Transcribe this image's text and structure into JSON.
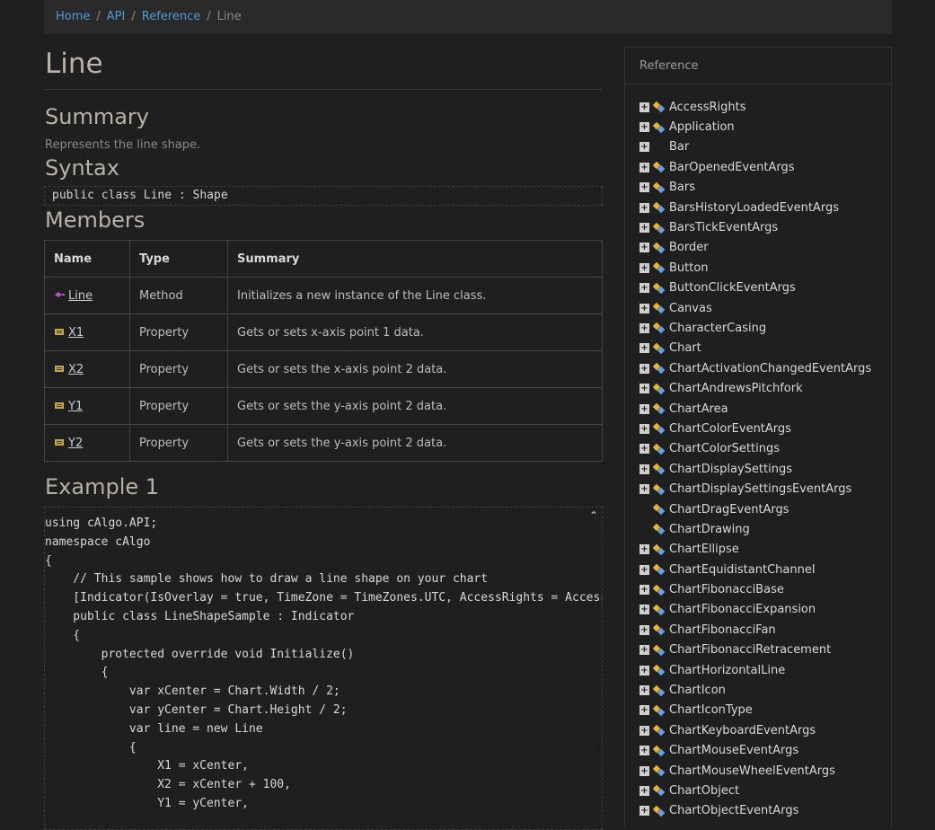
{
  "breadcrumb": {
    "items": [
      "Home",
      "API",
      "Reference"
    ],
    "current": "Line"
  },
  "page": {
    "title": "Line",
    "summary_heading": "Summary",
    "summary_text": "Represents the line shape.",
    "syntax_heading": "Syntax",
    "syntax_code": "public class Line : Shape",
    "members_heading": "Members",
    "example_heading": "Example 1"
  },
  "members_table": {
    "headers": [
      "Name",
      "Type",
      "Summary"
    ],
    "rows": [
      {
        "name": "Line",
        "type": "Method",
        "summary": "Initializes a new instance of the Line class.",
        "icon": "method-icon"
      },
      {
        "name": "X1",
        "type": "Property",
        "summary": "Gets or sets x-axis point 1 data.",
        "icon": "property-icon"
      },
      {
        "name": "X2",
        "type": "Property",
        "summary": "Gets or sets the x-axis point 2 data.",
        "icon": "property-icon"
      },
      {
        "name": "Y1",
        "type": "Property",
        "summary": "Gets or sets the y-axis point 2 data.",
        "icon": "property-icon"
      },
      {
        "name": "Y2",
        "type": "Property",
        "summary": "Gets or sets the y-axis point 2 data.",
        "icon": "property-icon"
      }
    ]
  },
  "example_code": "using cAlgo.API;\nnamespace cAlgo\n{\n    // This sample shows how to draw a line shape on your chart\n    [Indicator(IsOverlay = true, TimeZone = TimeZones.UTC, AccessRights = AccessRights.None)]\n    public class LineShapeSample : Indicator\n    {\n        protected override void Initialize()\n        {\n            var xCenter = Chart.Width / 2;\n            var yCenter = Chart.Height / 2;\n            var line = new Line\n            {\n                X1 = xCenter,\n                X2 = xCenter + 100,\n                Y1 = yCenter,",
  "sidebar": {
    "heading": "Reference",
    "items": [
      {
        "label": "AccessRights",
        "expandable": true,
        "icon": true
      },
      {
        "label": "Application",
        "expandable": true,
        "icon": true
      },
      {
        "label": "Bar",
        "expandable": true,
        "icon": false
      },
      {
        "label": "BarOpenedEventArgs",
        "expandable": true,
        "icon": true
      },
      {
        "label": "Bars",
        "expandable": true,
        "icon": true
      },
      {
        "label": "BarsHistoryLoadedEventArgs",
        "expandable": true,
        "icon": true
      },
      {
        "label": "BarsTickEventArgs",
        "expandable": true,
        "icon": true
      },
      {
        "label": "Border",
        "expandable": true,
        "icon": true
      },
      {
        "label": "Button",
        "expandable": true,
        "icon": true
      },
      {
        "label": "ButtonClickEventArgs",
        "expandable": true,
        "icon": true
      },
      {
        "label": "Canvas",
        "expandable": true,
        "icon": true
      },
      {
        "label": "CharacterCasing",
        "expandable": true,
        "icon": true
      },
      {
        "label": "Chart",
        "expandable": true,
        "icon": true
      },
      {
        "label": "ChartActivationChangedEventArgs",
        "expandable": true,
        "icon": true
      },
      {
        "label": "ChartAndrewsPitchfork",
        "expandable": true,
        "icon": true
      },
      {
        "label": "ChartArea",
        "expandable": true,
        "icon": true
      },
      {
        "label": "ChartColorEventArgs",
        "expandable": true,
        "icon": true
      },
      {
        "label": "ChartColorSettings",
        "expandable": true,
        "icon": true
      },
      {
        "label": "ChartDisplaySettings",
        "expandable": true,
        "icon": true
      },
      {
        "label": "ChartDisplaySettingsEventArgs",
        "expandable": true,
        "icon": true
      },
      {
        "label": "ChartDragEventArgs",
        "expandable": false,
        "icon": true
      },
      {
        "label": "ChartDrawing",
        "expandable": false,
        "icon": true
      },
      {
        "label": "ChartEllipse",
        "expandable": true,
        "icon": true
      },
      {
        "label": "ChartEquidistantChannel",
        "expandable": true,
        "icon": true
      },
      {
        "label": "ChartFibonacciBase",
        "expandable": true,
        "icon": true
      },
      {
        "label": "ChartFibonacciExpansion",
        "expandable": true,
        "icon": true
      },
      {
        "label": "ChartFibonacciFan",
        "expandable": true,
        "icon": true
      },
      {
        "label": "ChartFibonacciRetracement",
        "expandable": true,
        "icon": true
      },
      {
        "label": "ChartHorizontalLine",
        "expandable": true,
        "icon": true
      },
      {
        "label": "ChartIcon",
        "expandable": true,
        "icon": true
      },
      {
        "label": "ChartIconType",
        "expandable": true,
        "icon": true
      },
      {
        "label": "ChartKeyboardEventArgs",
        "expandable": true,
        "icon": true
      },
      {
        "label": "ChartMouseEventArgs",
        "expandable": true,
        "icon": true
      },
      {
        "label": "ChartMouseWheelEventArgs",
        "expandable": true,
        "icon": true
      },
      {
        "label": "ChartObject",
        "expandable": true,
        "icon": true
      },
      {
        "label": "ChartObjectEventArgs",
        "expandable": true,
        "icon": true
      }
    ]
  }
}
